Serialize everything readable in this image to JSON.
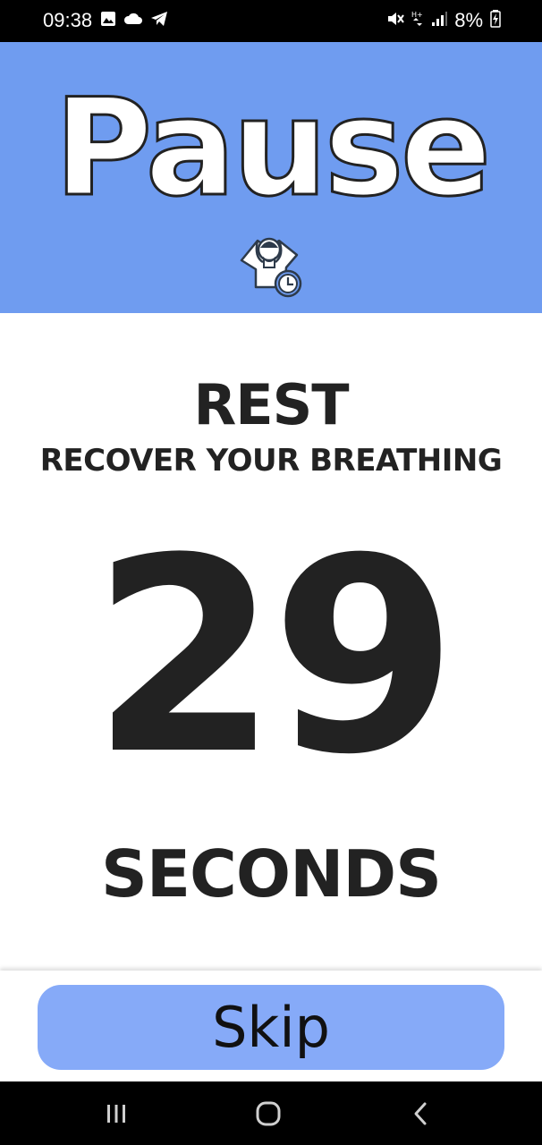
{
  "status_bar": {
    "time": "09:38",
    "battery": "8%",
    "left_icons": [
      "gallery-icon",
      "cloud-icon",
      "telegram-icon"
    ],
    "right_icons": [
      "mute-icon",
      "data-transfer-icon",
      "signal-icon",
      "battery-charging-icon"
    ]
  },
  "header": {
    "title": "Pause",
    "icon": "rest-person-clock-icon",
    "background": "#6f9cf0"
  },
  "content": {
    "title": "REST",
    "subtitle": "RECOVER YOUR BREATHING",
    "countdown": "29",
    "unit": "SECONDS"
  },
  "actions": {
    "skip_label": "Skip",
    "skip_color": "#86aaf8"
  },
  "nav_bar": {
    "buttons": [
      "recent-apps-icon",
      "home-icon",
      "back-icon"
    ]
  }
}
